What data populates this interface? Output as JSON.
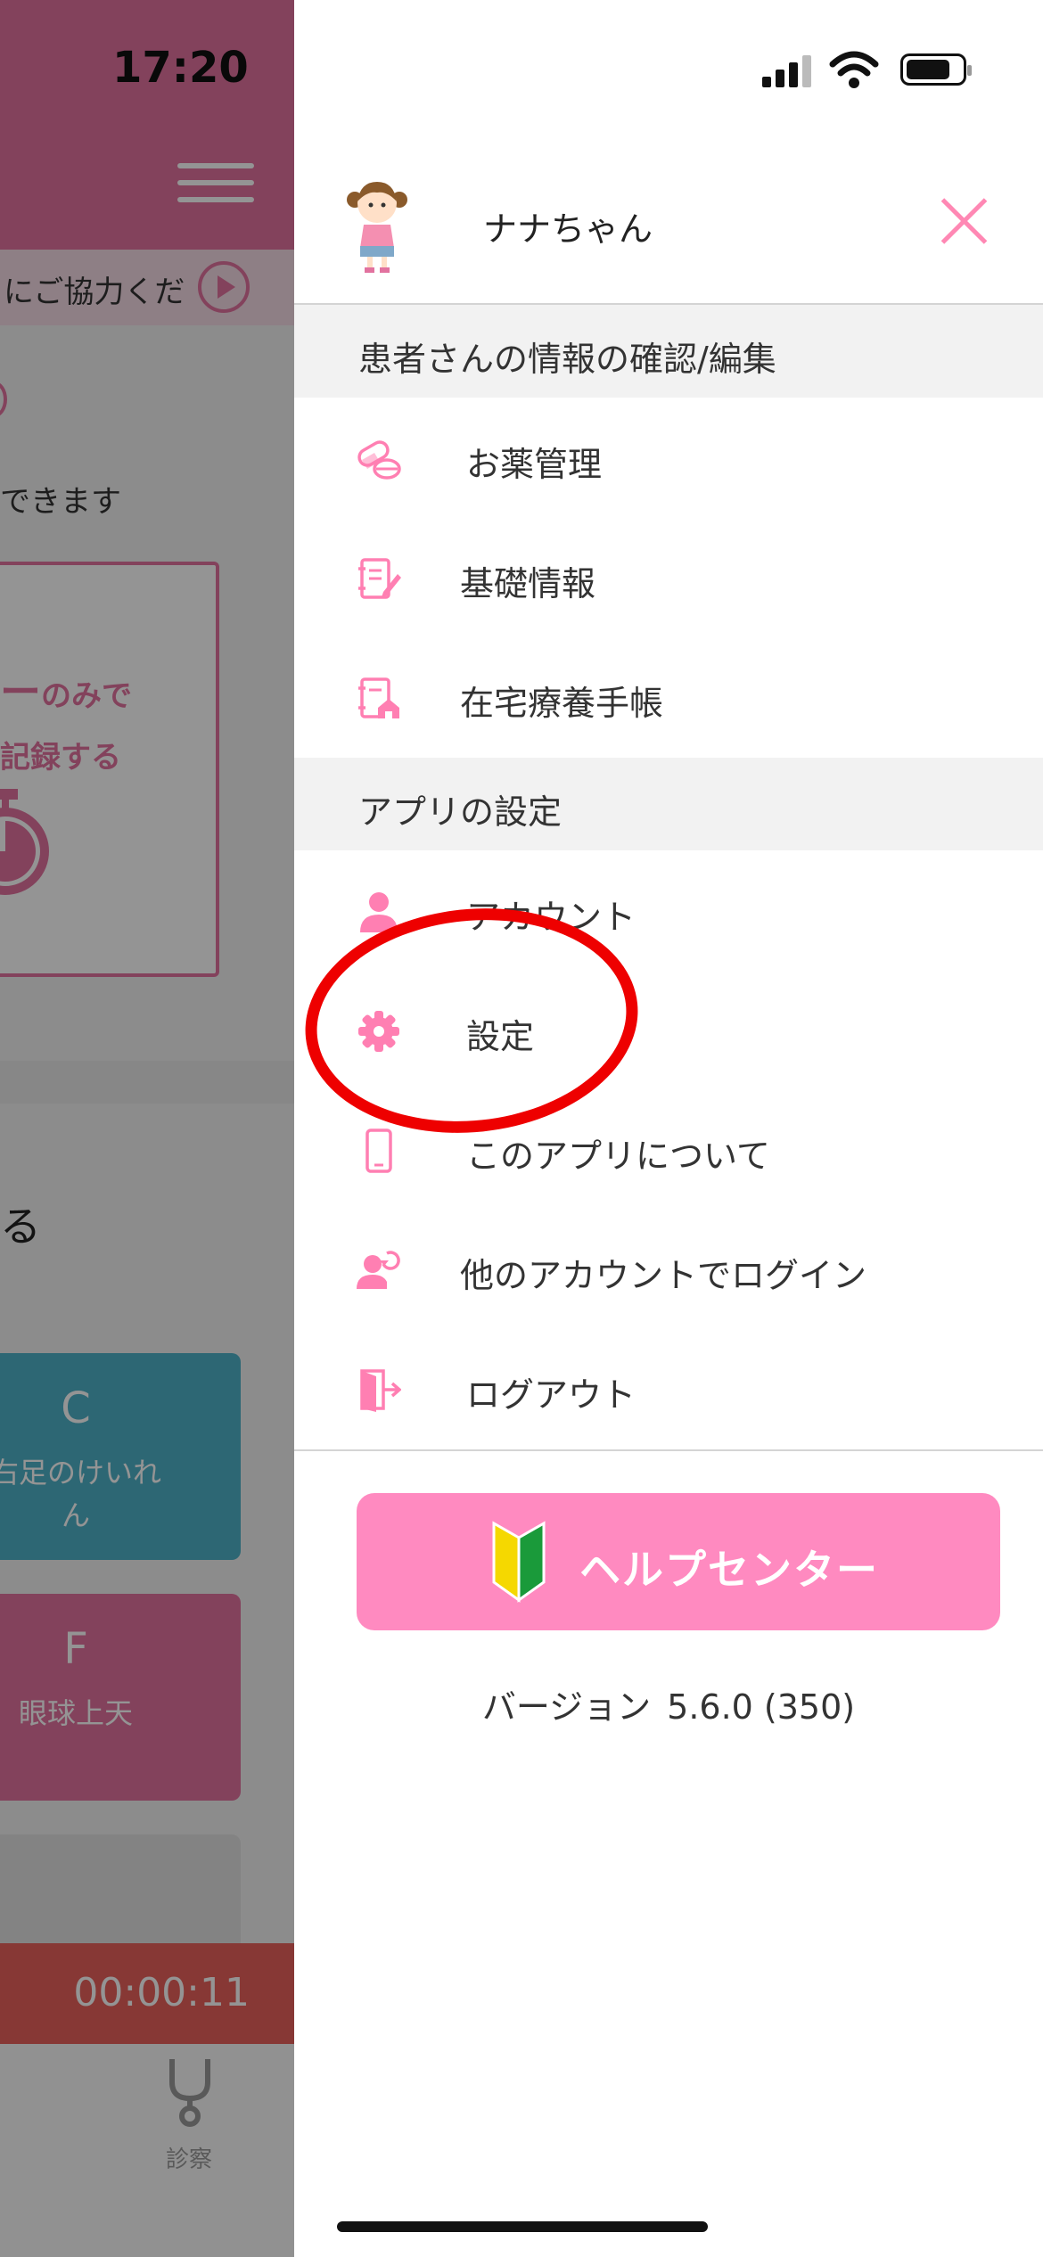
{
  "status_bar": {
    "time": "17:20"
  },
  "background_app": {
    "notice_text": "にご協力くだ",
    "can_text": "できます",
    "timer_card": {
      "line1_big": "ー",
      "line1_small": "のみで",
      "line2": "記録する"
    },
    "section_text": "る",
    "cards": [
      {
        "letter": "C",
        "label": "右足のけいれん",
        "label_line1": "右足のけいれ",
        "label_line2": "ん",
        "color": "#4fb2c8"
      },
      {
        "letter": "F",
        "label": "眼球上天",
        "color": "#e2729f"
      }
    ],
    "elapsed_time": "00:00:11",
    "tabs": [
      {
        "label": "診察",
        "icon": "stethoscope-icon"
      }
    ]
  },
  "drawer": {
    "profile": {
      "name": "ナナちゃん",
      "avatar_icon": "girl-avatar-icon"
    },
    "sections": [
      {
        "title": "患者さんの情報の確認/編集",
        "items": [
          {
            "label": "お薬管理",
            "icon": "pills-icon"
          },
          {
            "label": "基礎情報",
            "icon": "notebook-pen-icon"
          },
          {
            "label": "在宅療養手帳",
            "icon": "home-notebook-icon"
          }
        ]
      },
      {
        "title": "アプリの設定",
        "items": [
          {
            "label": "アカウント",
            "icon": "person-icon"
          },
          {
            "label": "設定",
            "icon": "gear-icon"
          },
          {
            "label": "このアプリについて",
            "icon": "smartphone-icon"
          },
          {
            "label": "他のアカウントでログイン",
            "icon": "switch-account-icon"
          },
          {
            "label": "ログアウト",
            "icon": "logout-door-icon"
          }
        ]
      }
    ],
    "help_button": {
      "label": "ヘルプセンター",
      "icon": "beginner-mark-icon"
    },
    "version": {
      "label": "バージョン",
      "value": "5.6.0 (350)"
    }
  },
  "colors": {
    "brand_pink": "#ff8ac0",
    "header_pink": "#e2729f",
    "annotation_red": "#ee0000"
  }
}
